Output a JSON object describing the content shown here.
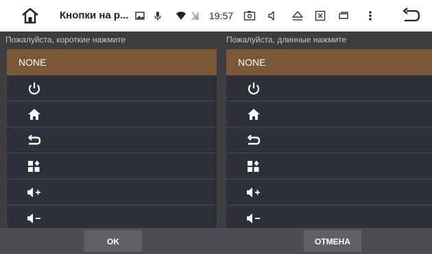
{
  "statusbar": {
    "title": "Кнопки на р...",
    "time": "19:57"
  },
  "columns": {
    "short_caption": "Пожалуйста, короткие нажмите",
    "long_caption": "Пожалуйста, длинные нажмите"
  },
  "short_options": [
    {
      "label": "NONE",
      "icon": null
    },
    {
      "label": "",
      "icon": "power-icon"
    },
    {
      "label": "",
      "icon": "home-icon"
    },
    {
      "label": "",
      "icon": "back-arrow-icon"
    },
    {
      "label": "",
      "icon": "apps-icon"
    },
    {
      "label": "",
      "icon": "volume-up-icon"
    },
    {
      "label": "",
      "icon": "volume-down-icon"
    }
  ],
  "long_options": [
    {
      "label": "NONE",
      "icon": null
    },
    {
      "label": "",
      "icon": "power-icon"
    },
    {
      "label": "",
      "icon": "home-icon"
    },
    {
      "label": "",
      "icon": "back-arrow-icon"
    },
    {
      "label": "",
      "icon": "apps-icon"
    },
    {
      "label": "",
      "icon": "volume-up-icon"
    },
    {
      "label": "",
      "icon": "volume-down-icon"
    }
  ],
  "buttons": {
    "ok": "OK",
    "cancel": "ОТМЕНА"
  },
  "colors": {
    "selected": "#7a5736",
    "panel": "#2c3037",
    "status_bar": "#ffffff"
  }
}
